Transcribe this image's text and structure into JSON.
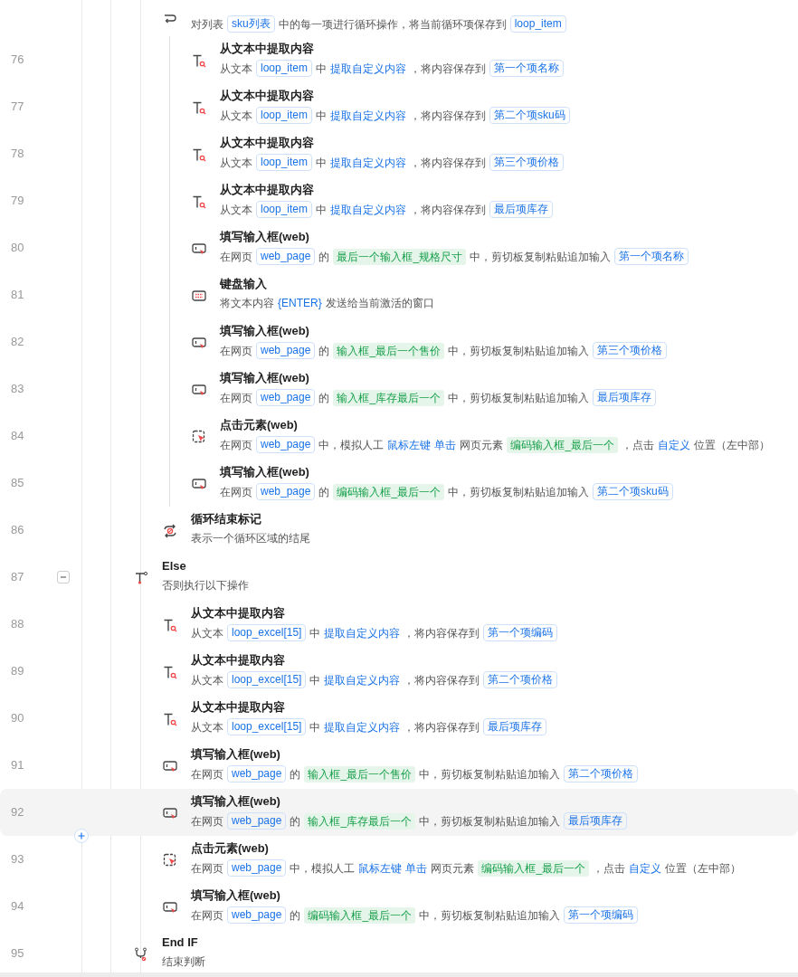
{
  "steps": [
    {
      "children": [
        {
          "kind": "loop",
          "selected": false,
          "desc": [
            {
              "kind": "t",
              "text": "对列表"
            },
            {
              "kind": "var",
              "text": "sku列表"
            },
            {
              "kind": "t",
              "text": "中的每一项进行循环操作，将当前循环项保存到"
            },
            {
              "kind": "var",
              "text": "loop_item"
            }
          ],
          "children": [
            {
              "line": "76",
              "title": "从文本中提取内容",
              "kind": "extract",
              "selected": false,
              "desc": [
                {
                  "kind": "t",
                  "text": "从文本"
                },
                {
                  "kind": "var",
                  "text": "loop_item"
                },
                {
                  "kind": "t",
                  "text": "中"
                },
                {
                  "kind": "kw",
                  "text": "提取自定义内容"
                },
                {
                  "kind": "t",
                  "text": "，将内容保存到"
                },
                {
                  "kind": "var",
                  "text": "第一个项名称"
                }
              ]
            },
            {
              "line": "77",
              "title": "从文本中提取内容",
              "kind": "extract",
              "selected": false,
              "desc": [
                {
                  "kind": "t",
                  "text": "从文本"
                },
                {
                  "kind": "var",
                  "text": "loop_item"
                },
                {
                  "kind": "t",
                  "text": "中"
                },
                {
                  "kind": "kw",
                  "text": "提取自定义内容"
                },
                {
                  "kind": "t",
                  "text": "，将内容保存到"
                },
                {
                  "kind": "var",
                  "text": "第二个项sku码"
                }
              ]
            },
            {
              "line": "78",
              "title": "从文本中提取内容",
              "kind": "extract",
              "selected": false,
              "desc": [
                {
                  "kind": "t",
                  "text": "从文本"
                },
                {
                  "kind": "var",
                  "text": "loop_item"
                },
                {
                  "kind": "t",
                  "text": "中"
                },
                {
                  "kind": "kw",
                  "text": "提取自定义内容"
                },
                {
                  "kind": "t",
                  "text": "，将内容保存到"
                },
                {
                  "kind": "var",
                  "text": "第三个项价格"
                }
              ]
            },
            {
              "line": "79",
              "title": "从文本中提取内容",
              "kind": "extract",
              "selected": false,
              "desc": [
                {
                  "kind": "t",
                  "text": "从文本"
                },
                {
                  "kind": "var",
                  "text": "loop_item"
                },
                {
                  "kind": "t",
                  "text": "中"
                },
                {
                  "kind": "kw",
                  "text": "提取自定义内容"
                },
                {
                  "kind": "t",
                  "text": "，将内容保存到"
                },
                {
                  "kind": "var",
                  "text": "最后项库存"
                }
              ]
            },
            {
              "line": "80",
              "title": "填写输入框(web)",
              "kind": "fill",
              "selected": false,
              "desc": [
                {
                  "kind": "t",
                  "text": "在网页"
                },
                {
                  "kind": "var",
                  "text": "web_page"
                },
                {
                  "kind": "t",
                  "text": "的"
                },
                {
                  "kind": "el",
                  "text": "最后一个输入框_规格尺寸"
                },
                {
                  "kind": "t",
                  "text": "中，剪切板复制粘贴追加输入"
                },
                {
                  "kind": "var",
                  "text": "第一个项名称"
                }
              ]
            },
            {
              "line": "81",
              "title": "键盘输入",
              "kind": "keyboard",
              "selected": false,
              "desc": [
                {
                  "kind": "t",
                  "text": "将文本内容"
                },
                {
                  "kind": "kw",
                  "text": "{ENTER}"
                },
                {
                  "kind": "t",
                  "text": "发送给当前激活的窗口"
                }
              ]
            },
            {
              "line": "82",
              "title": "填写输入框(web)",
              "kind": "fill",
              "selected": false,
              "desc": [
                {
                  "kind": "t",
                  "text": "在网页"
                },
                {
                  "kind": "var",
                  "text": "web_page"
                },
                {
                  "kind": "t",
                  "text": "的"
                },
                {
                  "kind": "el",
                  "text": "输入框_最后一个售价"
                },
                {
                  "kind": "t",
                  "text": "中，剪切板复制粘贴追加输入"
                },
                {
                  "kind": "var",
                  "text": "第三个项价格"
                }
              ]
            },
            {
              "line": "83",
              "title": "填写输入框(web)",
              "kind": "fill",
              "selected": false,
              "desc": [
                {
                  "kind": "t",
                  "text": "在网页"
                },
                {
                  "kind": "var",
                  "text": "web_page"
                },
                {
                  "kind": "t",
                  "text": "的"
                },
                {
                  "kind": "el",
                  "text": "输入框_库存最后一个"
                },
                {
                  "kind": "t",
                  "text": "中，剪切板复制粘贴追加输入"
                },
                {
                  "kind": "var",
                  "text": "最后项库存"
                }
              ]
            },
            {
              "line": "84",
              "title": "点击元素(web)",
              "kind": "click",
              "selected": false,
              "desc": [
                {
                  "kind": "t",
                  "text": "在网页"
                },
                {
                  "kind": "var",
                  "text": "web_page"
                },
                {
                  "kind": "t",
                  "text": "中，模拟人工"
                },
                {
                  "kind": "kw",
                  "text": "鼠标左键"
                },
                {
                  "kind": "kw",
                  "text": "单击"
                },
                {
                  "kind": "t",
                  "text": "网页元素"
                },
                {
                  "kind": "el",
                  "text": "编码输入框_最后一个"
                },
                {
                  "kind": "t",
                  "text": "，点击"
                },
                {
                  "kind": "kw",
                  "text": "自定义"
                },
                {
                  "kind": "t",
                  "text": "位置（左中部）"
                }
              ]
            },
            {
              "line": "85",
              "title": "填写输入框(web)",
              "kind": "fill",
              "selected": false,
              "desc": [
                {
                  "kind": "t",
                  "text": "在网页"
                },
                {
                  "kind": "var",
                  "text": "web_page"
                },
                {
                  "kind": "t",
                  "text": "的"
                },
                {
                  "kind": "el",
                  "text": "编码输入框_最后一个"
                },
                {
                  "kind": "t",
                  "text": "中，剪切板复制粘贴追加输入"
                },
                {
                  "kind": "var",
                  "text": "第二个项sku码"
                }
              ]
            }
          ]
        },
        {
          "line": "86",
          "title": "循环结束标记",
          "kind": "loop_end",
          "selected": false,
          "desc": [
            {
              "kind": "t",
              "text": "表示一个循环区域的结尾"
            }
          ]
        }
      ]
    },
    {
      "line": "87",
      "title": "Else",
      "kind": "else",
      "expanded": true,
      "selected": false,
      "desc": [
        {
          "kind": "t",
          "text": "否则执行以下操作"
        }
      ],
      "children": [
        {
          "line": "88",
          "title": "从文本中提取内容",
          "kind": "extract",
          "selected": false,
          "desc": [
            {
              "kind": "t",
              "text": "从文本"
            },
            {
              "kind": "var",
              "text": "loop_excel[15]"
            },
            {
              "kind": "t",
              "text": "中"
            },
            {
              "kind": "kw",
              "text": "提取自定义内容"
            },
            {
              "kind": "t",
              "text": "，将内容保存到"
            },
            {
              "kind": "var",
              "text": "第一个项编码"
            }
          ]
        },
        {
          "line": "89",
          "title": "从文本中提取内容",
          "kind": "extract",
          "selected": false,
          "desc": [
            {
              "kind": "t",
              "text": "从文本"
            },
            {
              "kind": "var",
              "text": "loop_excel[15]"
            },
            {
              "kind": "t",
              "text": "中"
            },
            {
              "kind": "kw",
              "text": "提取自定义内容"
            },
            {
              "kind": "t",
              "text": "，将内容保存到"
            },
            {
              "kind": "var",
              "text": "第二个项价格"
            }
          ]
        },
        {
          "line": "90",
          "title": "从文本中提取内容",
          "kind": "extract",
          "selected": false,
          "desc": [
            {
              "kind": "t",
              "text": "从文本"
            },
            {
              "kind": "var",
              "text": "loop_excel[15]"
            },
            {
              "kind": "t",
              "text": "中"
            },
            {
              "kind": "kw",
              "text": "提取自定义内容"
            },
            {
              "kind": "t",
              "text": "，将内容保存到"
            },
            {
              "kind": "var",
              "text": "最后项库存"
            }
          ]
        },
        {
          "line": "91",
          "title": "填写输入框(web)",
          "kind": "fill",
          "selected": false,
          "desc": [
            {
              "kind": "t",
              "text": "在网页"
            },
            {
              "kind": "var",
              "text": "web_page"
            },
            {
              "kind": "t",
              "text": "的"
            },
            {
              "kind": "el",
              "text": "输入框_最后一个售价"
            },
            {
              "kind": "t",
              "text": "中，剪切板复制粘贴追加输入"
            },
            {
              "kind": "var",
              "text": "第二个项价格"
            }
          ]
        },
        {
          "line": "92",
          "title": "填写输入框(web)",
          "kind": "fill",
          "selected": true,
          "desc": [
            {
              "kind": "t",
              "text": "在网页"
            },
            {
              "kind": "var",
              "text": "web_page"
            },
            {
              "kind": "t",
              "text": "的"
            },
            {
              "kind": "el",
              "text": "输入框_库存最后一个"
            },
            {
              "kind": "t",
              "text": "中，剪切板复制粘贴追加输入"
            },
            {
              "kind": "var",
              "text": "最后项库存"
            }
          ]
        },
        {
          "line": "93",
          "title": "点击元素(web)",
          "kind": "click",
          "selected": false,
          "desc": [
            {
              "kind": "t",
              "text": "在网页"
            },
            {
              "kind": "var",
              "text": "web_page"
            },
            {
              "kind": "t",
              "text": "中，模拟人工"
            },
            {
              "kind": "kw",
              "text": "鼠标左键"
            },
            {
              "kind": "kw",
              "text": "单击"
            },
            {
              "kind": "t",
              "text": "网页元素"
            },
            {
              "kind": "el",
              "text": "编码输入框_最后一个"
            },
            {
              "kind": "t",
              "text": "，点击"
            },
            {
              "kind": "kw",
              "text": "自定义"
            },
            {
              "kind": "t",
              "text": "位置（左中部）"
            }
          ]
        },
        {
          "line": "94",
          "title": "填写输入框(web)",
          "kind": "fill",
          "selected": false,
          "desc": [
            {
              "kind": "t",
              "text": "在网页"
            },
            {
              "kind": "var",
              "text": "web_page"
            },
            {
              "kind": "t",
              "text": "的"
            },
            {
              "kind": "el",
              "text": "编码输入框_最后一个"
            },
            {
              "kind": "t",
              "text": "中，剪切板复制粘贴追加输入"
            },
            {
              "kind": "var",
              "text": "第一个项编码"
            }
          ]
        }
      ]
    },
    {
      "line": "95",
      "title": "End IF",
      "kind": "endif",
      "selected": false,
      "desc": [
        {
          "kind": "t",
          "text": "结束判断"
        }
      ]
    }
  ]
}
